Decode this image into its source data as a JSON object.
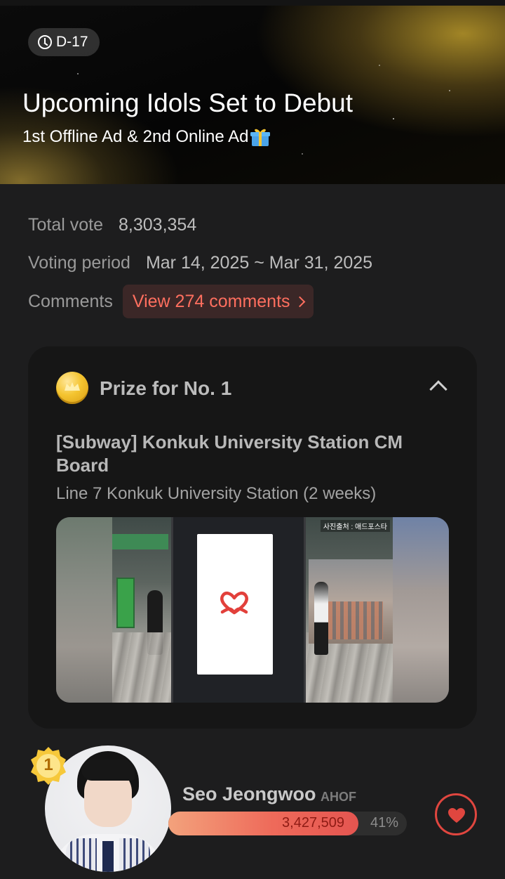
{
  "banner": {
    "dday": "D-17",
    "title": "Upcoming Idols Set to Debut",
    "subtitle": "1st Offline Ad & 2nd Online Ad"
  },
  "info": {
    "total_vote_label": "Total vote",
    "total_vote_value": "8,303,354",
    "period_label": "Voting period",
    "period_value": "Mar 14, 2025 ~ Mar 31, 2025",
    "comments_label": "Comments",
    "comments_button": "View 274 comments"
  },
  "prize": {
    "title": "Prize for No. 1",
    "name": "[Subway] Konkuk University Station CM Board",
    "location": "Line 7 Konkuk University Station (2 weeks)",
    "photo_credit": "사진출처 : 애드포스타"
  },
  "ranking": [
    {
      "rank": "1",
      "name": "Seo Jeongwoo",
      "group": "AHOF",
      "votes": "3,427,509",
      "percent": "41%",
      "share": 0.41
    }
  ],
  "colors": {
    "accent": "#ee6a5a",
    "background": "#1d1d1e",
    "card": "#161616",
    "comments_text": "#ff6f5f"
  }
}
